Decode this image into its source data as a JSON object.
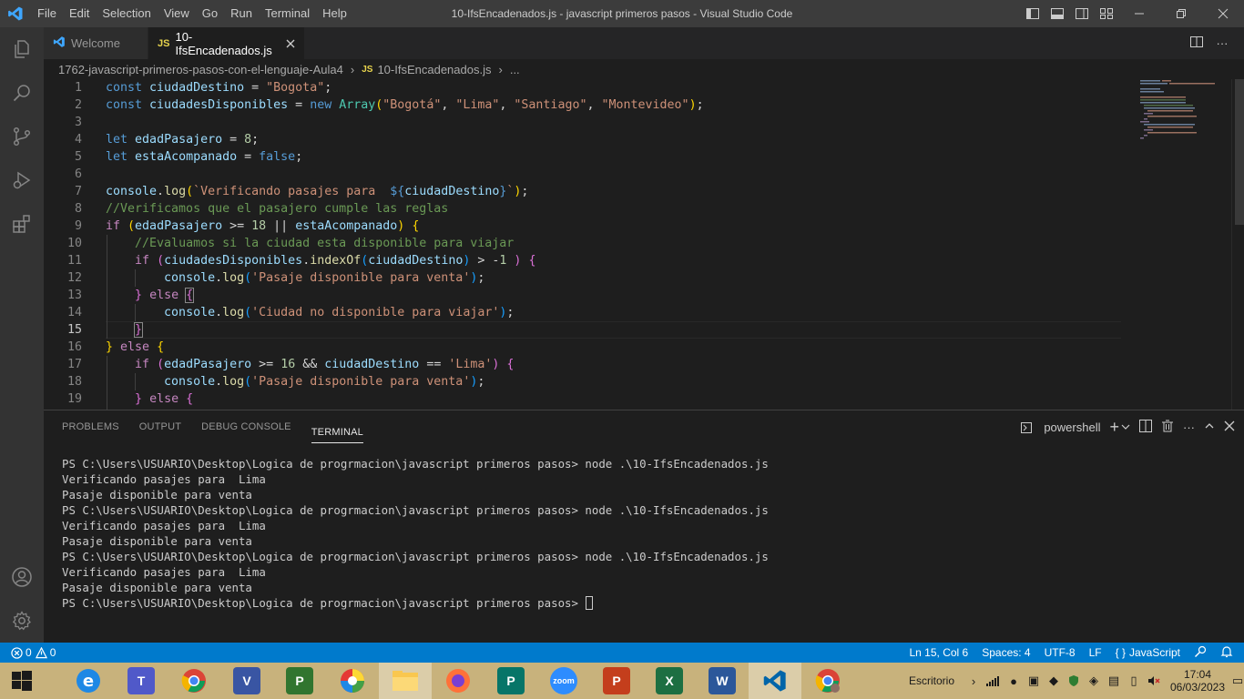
{
  "window": {
    "title": "10-IfsEncadenados.js - javascript primeros pasos - Visual Studio Code",
    "menu": [
      "File",
      "Edit",
      "Selection",
      "View",
      "Go",
      "Run",
      "Terminal",
      "Help"
    ]
  },
  "tabs": [
    {
      "label": "Welcome",
      "active": false
    },
    {
      "label": "10-IfsEncadenados.js",
      "active": true,
      "icon_text": "JS"
    }
  ],
  "breadcrumb": {
    "folder": "1762-javascript-primeros-pasos-con-el-lenguaje-Aula4",
    "file_icon_text": "JS",
    "file": "10-IfsEncadenados.js",
    "more": "..."
  },
  "editor": {
    "line_numbers": [
      "1",
      "2",
      "3",
      "4",
      "5",
      "6",
      "7",
      "8",
      "9",
      "10",
      "11",
      "12",
      "13",
      "14",
      "15",
      "16",
      "17",
      "18",
      "19"
    ],
    "current_line": "15"
  },
  "panel": {
    "tabs": [
      "PROBLEMS",
      "OUTPUT",
      "DEBUG CONSOLE",
      "TERMINAL"
    ],
    "active_tab": "TERMINAL",
    "shell_label": "powershell",
    "terminal_lines": [
      "PS C:\\Users\\USUARIO\\Desktop\\Logica de progrmacion\\javascript primeros pasos> node .\\10-IfsEncadenados.js",
      "Verificando pasajes para  Lima",
      "Pasaje disponible para venta",
      "PS C:\\Users\\USUARIO\\Desktop\\Logica de progrmacion\\javascript primeros pasos> node .\\10-IfsEncadenados.js",
      "Verificando pasajes para  Lima",
      "Pasaje disponible para venta",
      "PS C:\\Users\\USUARIO\\Desktop\\Logica de progrmacion\\javascript primeros pasos> node .\\10-IfsEncadenados.js",
      "Verificando pasajes para  Lima",
      "Pasaje disponible para venta"
    ],
    "prompt": "PS C:\\Users\\USUARIO\\Desktop\\Logica de progrmacion\\javascript primeros pasos> "
  },
  "status": {
    "errors": "0",
    "warnings": "0",
    "position": "Ln 15, Col 6",
    "spaces": "Spaces: 4",
    "encoding": "UTF-8",
    "eol": "LF",
    "language": "JavaScript",
    "brace_icon": "{ }"
  },
  "taskbar": {
    "tray_label": "Escritorio",
    "time": "17:04",
    "date": "06/03/2023",
    "apps": [
      "edge",
      "teams",
      "chrome",
      "visio",
      "project",
      "excel-green",
      "color-app",
      "explorer",
      "firefox",
      "publisher",
      "zoom",
      "powerpoint",
      "excel",
      "word",
      "vscode",
      "chrome-profile"
    ]
  },
  "colors": {
    "accent": "#007acc",
    "editor_bg": "#1e1e1e",
    "titlebar_bg": "#3c3c3c",
    "activitybar_bg": "#333333",
    "taskbar_bg": "#c8b27c"
  }
}
